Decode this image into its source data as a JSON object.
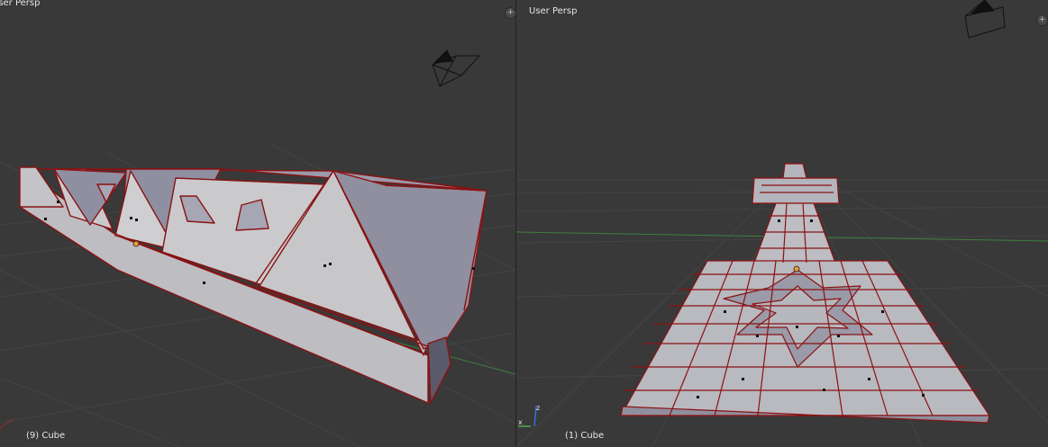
{
  "left_viewport": {
    "view_label": "User Persp",
    "object_info": "(9) Cube",
    "plus_symbol": "+"
  },
  "right_viewport": {
    "view_label": "User Persp",
    "object_info": "(1) Cube",
    "plus_symbol": "+",
    "axis_labels": {
      "x": "x",
      "z": "z"
    }
  },
  "colors": {
    "background": "#393939",
    "grid": "#444444",
    "x_axis": "#3f7f3f",
    "mesh_face": "#c7c7cc",
    "mesh_shade": "#8f8fa0",
    "edge_selected": "#9a1a1a"
  }
}
